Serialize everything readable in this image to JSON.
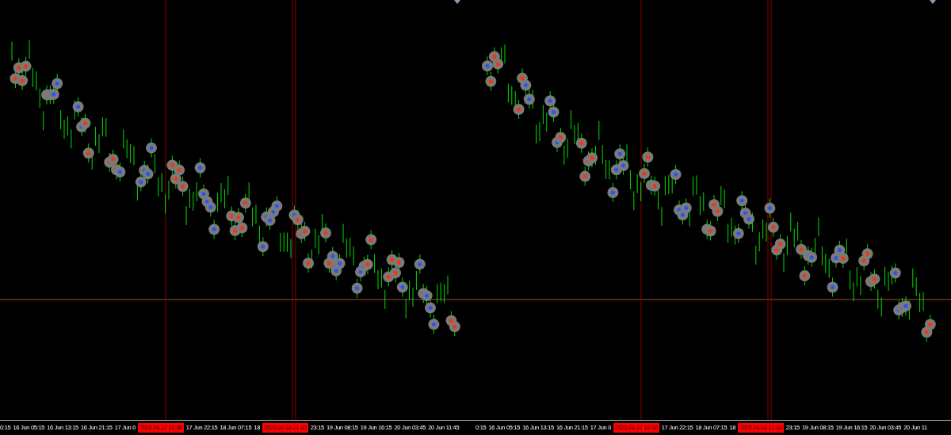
{
  "panels": [
    {
      "axis_labels": [
        {
          "text": "0:15",
          "kind": "tick"
        },
        {
          "text": "16 Jun 05:15",
          "kind": "tick"
        },
        {
          "text": "16 Jun 13:15",
          "kind": "tick"
        },
        {
          "text": "16 Jun 21:15",
          "kind": "tick"
        },
        {
          "text": "17 Jun 0",
          "kind": "tick"
        },
        {
          "text": "2025.06.17 15:30",
          "kind": "highlight"
        },
        {
          "text": "17 Jun 22:15",
          "kind": "tick"
        },
        {
          "text": "18 Jun 07:15",
          "kind": "tick"
        },
        {
          "text": "18",
          "kind": "tick"
        },
        {
          "text": "2025.06.18 21:30",
          "kind": "highlight"
        },
        {
          "text": "23:15",
          "kind": "tick"
        },
        {
          "text": "19 Jun 08:15",
          "kind": "tick"
        },
        {
          "text": "19 Jun 16:15",
          "kind": "tick"
        },
        {
          "text": "20 Jun 03:45",
          "kind": "tick"
        },
        {
          "text": "20 Jun 11:45",
          "kind": "tick"
        }
      ]
    },
    {
      "axis_labels": [
        {
          "text": "0:15",
          "kind": "tick"
        },
        {
          "text": "16 Jun 05:15",
          "kind": "tick"
        },
        {
          "text": "16 Jun 13:15",
          "kind": "tick"
        },
        {
          "text": "16 Jun 21:15",
          "kind": "tick"
        },
        {
          "text": "17 Jun 0",
          "kind": "tick"
        },
        {
          "text": "2025.06.17 15:30",
          "kind": "highlight"
        },
        {
          "text": "17 Jun 22:15",
          "kind": "tick"
        },
        {
          "text": "18 Jun 07:15",
          "kind": "tick"
        },
        {
          "text": "18",
          "kind": "tick"
        },
        {
          "text": "2025.06.18 21:30",
          "kind": "highlight"
        },
        {
          "text": "23:15",
          "kind": "tick"
        },
        {
          "text": "19 Jun 08:15",
          "kind": "tick"
        },
        {
          "text": "19 Jun 16:15",
          "kind": "tick"
        },
        {
          "text": "20 Jun 03:45",
          "kind": "tick"
        },
        {
          "text": "20 Jun 11"
        }
      ]
    }
  ]
}
